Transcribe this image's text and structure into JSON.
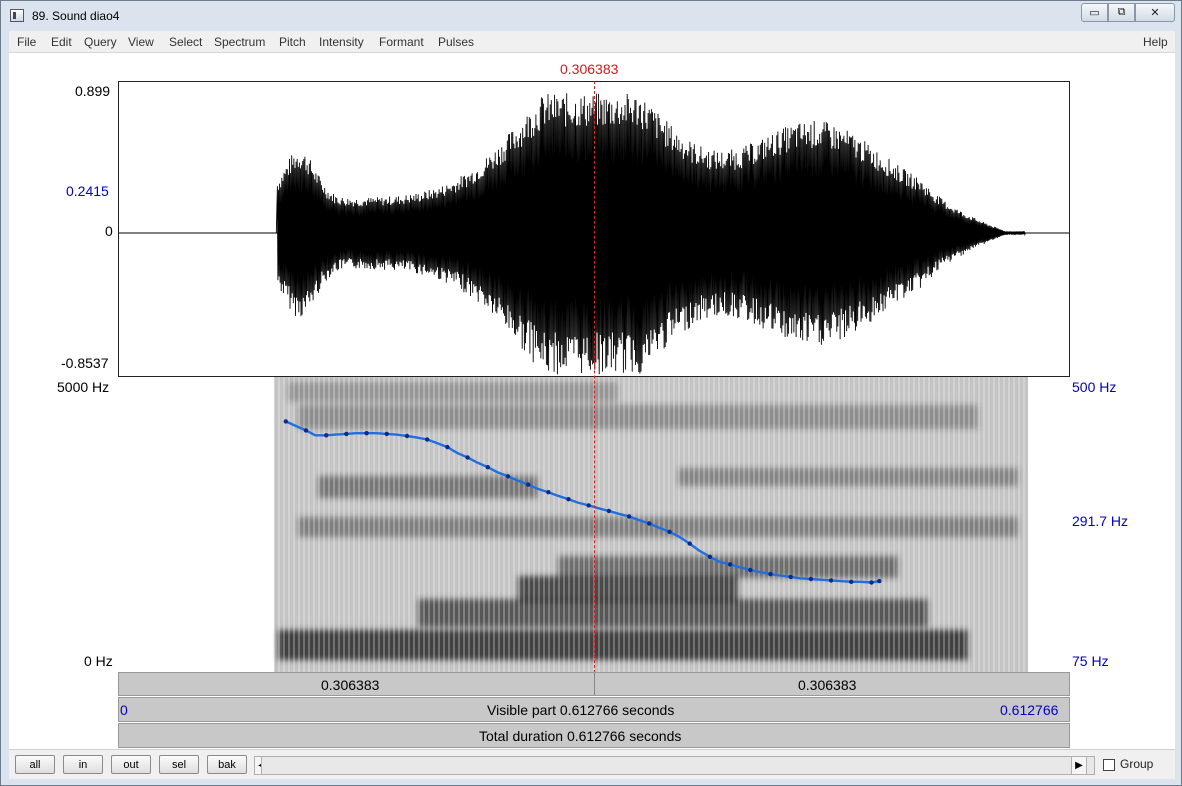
{
  "window": {
    "title": "89. Sound diao4",
    "controls": {
      "minimize": "▭",
      "maximize": "⧉",
      "close": "✕"
    }
  },
  "menu": [
    "File",
    "Edit",
    "Query",
    "View",
    "Select",
    "Spectrum",
    "Pitch",
    "Intensity",
    "Formant",
    "Pulses",
    "Help"
  ],
  "cursor_time": "0.306383",
  "waveform": {
    "y_max": "0.899",
    "y_mid": "0.2415",
    "y_zero": "0",
    "y_min": "-0.8537"
  },
  "spectrogram": {
    "freq_max": "5000 Hz",
    "freq_min": "0 Hz"
  },
  "pitch_axis": {
    "top": "500 Hz",
    "mid": "291.7 Hz",
    "bottom": "75 Hz"
  },
  "time_bar": {
    "left_segment": "0.306383",
    "right_segment": "0.306383"
  },
  "visible_bar": {
    "start": "0",
    "label": "Visible part 0.612766 seconds",
    "end": "0.612766"
  },
  "total_bar": {
    "label": "Total duration 0.612766 seconds"
  },
  "toolbar": {
    "buttons": [
      "all",
      "in",
      "out",
      "sel",
      "bak"
    ],
    "scroll_left": "◀",
    "scroll_right": "▶",
    "group_label": "Group",
    "group_checked": false
  },
  "colors": {
    "cursor": "#d21a1a",
    "pitch_contour": "#1f6fe0",
    "axis_label_blue": "#0000c8"
  },
  "chart_data": {
    "type": "line",
    "x_unit": "s",
    "y_unit": "Hz",
    "ylim": [
      75,
      500
    ],
    "xlim": [
      0,
      0.612766
    ],
    "x": [
      0.108,
      0.114,
      0.121,
      0.127,
      0.134,
      0.14,
      0.147,
      0.153,
      0.16,
      0.166,
      0.173,
      0.179,
      0.186,
      0.192,
      0.199,
      0.205,
      0.212,
      0.218,
      0.225,
      0.231,
      0.238,
      0.244,
      0.251,
      0.257,
      0.264,
      0.27,
      0.277,
      0.283,
      0.29,
      0.296,
      0.303,
      0.309,
      0.316,
      0.322,
      0.329,
      0.335,
      0.342,
      0.348,
      0.355,
      0.361,
      0.368,
      0.374,
      0.381,
      0.387,
      0.394,
      0.4,
      0.407,
      0.413,
      0.42,
      0.426,
      0.433,
      0.439,
      0.446,
      0.452,
      0.459,
      0.465,
      0.472,
      0.478,
      0.485,
      0.49
    ],
    "y": [
      436,
      430,
      423,
      416,
      416,
      417,
      418,
      419,
      419,
      419,
      418,
      417,
      415,
      413,
      410,
      405,
      399,
      391,
      384,
      377,
      370,
      363,
      357,
      351,
      345,
      339,
      334,
      329,
      324,
      319,
      315,
      311,
      307,
      303,
      299,
      294,
      289,
      283,
      277,
      270,
      260,
      250,
      241,
      234,
      230,
      226,
      222,
      219,
      216,
      214,
      212,
      210,
      209,
      208,
      207,
      206,
      205,
      205,
      204,
      206
    ]
  }
}
